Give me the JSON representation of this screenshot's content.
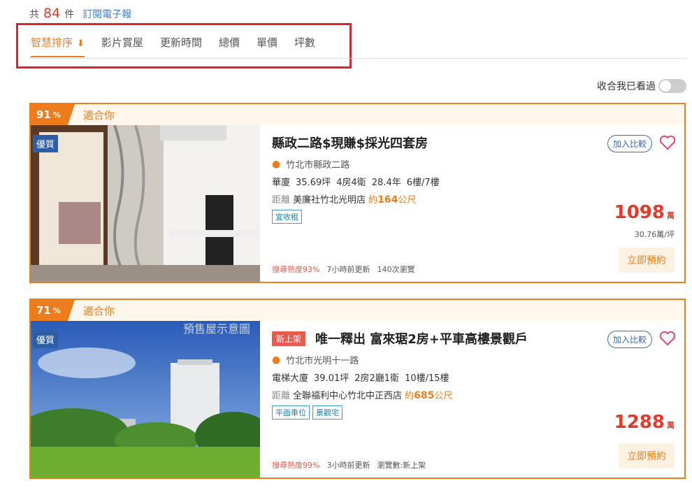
{
  "summary": {
    "prefix": "共",
    "count": "84",
    "suffix": "件",
    "subscribe": "訂閱電子報"
  },
  "sort_tabs": [
    {
      "label": "智慧排序",
      "icon": "arrow-down-icon",
      "active": true
    },
    {
      "label": "影片賞屋"
    },
    {
      "label": "更新時間"
    },
    {
      "label": "總價"
    },
    {
      "label": "單價"
    },
    {
      "label": "坪數"
    }
  ],
  "toggle": {
    "label": "收合我已看過",
    "on": false
  },
  "listings": [
    {
      "match": "91",
      "match_unit": "%",
      "fit": "適合你",
      "badge": "優質",
      "new_tag": "",
      "title": "縣政二路$現賺$採光四套房",
      "address": "竹北市縣政二路",
      "specs": [
        "華廈",
        "35.69坪",
        "4房4衛",
        "28.4年",
        "6樓/7樓"
      ],
      "distance": {
        "label": "距離",
        "place": "美廉社竹北光明店",
        "approx": "約",
        "value": "164",
        "unit": "公尺"
      },
      "tags": [
        "宜收租"
      ],
      "hot": "搜尋熱度93%",
      "updated": "7小時前更新",
      "views": "140次瀏覽",
      "compare": "加入比較",
      "price": "1098",
      "price_unit": "萬",
      "unit_price": "30.76萬/坪",
      "book": "立即預約"
    },
    {
      "match": "71",
      "match_unit": "%",
      "fit": "適合你",
      "badge": "優質",
      "new_tag": "新上架",
      "title": "唯一釋出 富來琚2房+平車高樓景觀戶",
      "address": "竹北市光明十一路",
      "specs": [
        "電梯大廈",
        "39.01坪",
        "2房2廳1衛",
        "10樓/15樓"
      ],
      "distance": {
        "label": "距離",
        "place": "全聯福利中心竹北中正西店",
        "approx": "約",
        "value": "685",
        "unit": "公尺"
      },
      "tags": [
        "平面車位",
        "景觀宅"
      ],
      "hot": "搜尋熱度99%",
      "updated": "3小時前更新",
      "views": "瀏覽數:新上架",
      "compare": "加入比較",
      "price": "1288",
      "price_unit": "萬",
      "unit_price": "",
      "book": "立即預約",
      "photo_caption": "預售屋示意圖"
    }
  ]
}
